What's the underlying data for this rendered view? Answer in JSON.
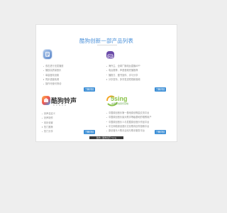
{
  "page": {
    "title": "酷狗创新一部产品列表"
  },
  "cards": [
    {
      "name": "",
      "icon": "app-icon-blue-scroll",
      "bullets": [
        "双击进行无损播放",
        "播放高质量音乐",
        "单曲音效设置",
        "同步进度精调",
        "操作可使可滑动"
      ],
      "button_label": "了解详情"
    },
    {
      "name": "",
      "icon": "app-icon-purple-radio",
      "bullets": [
        "海外主、全球广播电台直播APP",
        "电台推荐、声音音频完播推荐",
        "播报方、图书宣传、手与分享",
        "分享发布、多享发送短视频音频"
      ],
      "button_label": "了解详情"
    },
    {
      "name": "酷狗铃声",
      "subtitle": "KUGOU",
      "icon": "kugou-ringtone-logo",
      "bullets": [
        "铃声自定义",
        "铃声制作",
        "彩铃设置",
        "热门推荐",
        "热门分享"
      ],
      "button_label": "了解详情"
    },
    {
      "name": "5sing",
      "subtitle": "中国原创音乐基地",
      "icon": "5sing-logo",
      "bullets": [
        "中国原创音乐第一基地原创歌曲交流平台",
        "中国原创音乐最大歌手等级基地的唱歌用户",
        "中国原创音乐人与发掘原创音乐作品平台",
        "中文网络原创音乐文化歌词创作投稿平台",
        "原创音乐人歌手活动与歌手服务平台"
      ],
      "button_label": "了解详情"
    }
  ],
  "footer": {
    "note": "酷狗 | 酷狗铃声 5sing"
  },
  "colors": {
    "accent": "#3d8fd6",
    "title": "#4a90d9",
    "ringtone_green": "#3a3a3a",
    "5sing_green": "#8bc34a",
    "5sing_yellow": "#f5a623"
  }
}
